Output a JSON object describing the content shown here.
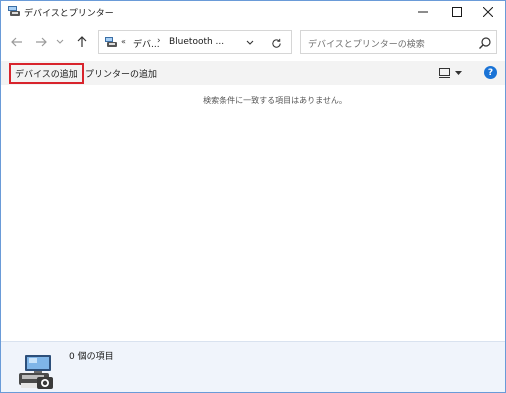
{
  "window": {
    "title": "デバイスとプリンター",
    "controls": [
      "minimize-icon",
      "maximize-icon",
      "close-icon"
    ]
  },
  "nav": {
    "back_icon": "arrow-left-icon",
    "forward_icon": "arrow-right-icon",
    "recent_icon": "chevron-down-icon",
    "up_icon": "arrow-up-icon"
  },
  "address": {
    "overflow": "«",
    "crumbs": [
      "デバ...",
      "Bluetooth ..."
    ],
    "separator": "›",
    "dropdown_icon": "chevron-down-icon",
    "refresh_icon": "refresh-icon"
  },
  "search": {
    "placeholder": "デバイスとプリンターの検索",
    "icon": "search-icon"
  },
  "commands": {
    "add_device": "デバイスの追加",
    "add_printer": "プリンターの追加",
    "view_icon": "view-options-icon",
    "help": "?"
  },
  "content": {
    "empty_message": "検索条件に一致する項目はありません。"
  },
  "details": {
    "icon": "devices-printer-icon",
    "item_count": "0 個の項目"
  },
  "colors": {
    "accent": "#1a73d6",
    "highlight_border": "#d8242c",
    "command_bar": "#f3f3f3",
    "details_pane": "#f0f4fb"
  }
}
